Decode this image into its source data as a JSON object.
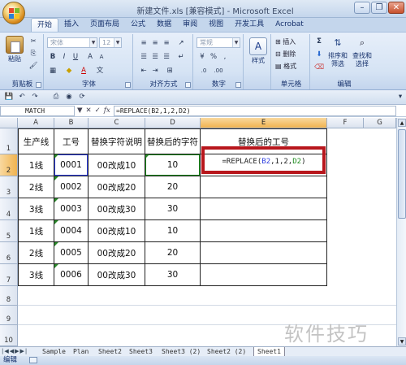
{
  "window": {
    "title": "新建文件.xls [兼容模式] - Microsoft Excel"
  },
  "tabs": [
    "开始",
    "插入",
    "页面布局",
    "公式",
    "数据",
    "审阅",
    "视图",
    "开发工具",
    "Acrobat"
  ],
  "ribbon": {
    "clipboard": {
      "label": "剪贴板",
      "paste": "粘贴"
    },
    "font": {
      "label": "字体",
      "family": "宋体",
      "size": "12"
    },
    "alignment": {
      "label": "对齐方式"
    },
    "number": {
      "label": "数字",
      "format": "常规"
    },
    "styles": {
      "label": "样式"
    },
    "cells": {
      "label": "单元格",
      "insert": "插入",
      "delete": "删除",
      "format": "格式"
    },
    "editing": {
      "label": "编辑",
      "sort": "排序和\n筛选",
      "find": "查找和\n选择"
    }
  },
  "formula_bar": {
    "name_box": "MATCH",
    "formula": "=REPLACE(B2,1,2,D2)",
    "fx": "fx"
  },
  "columns": [
    "A",
    "B",
    "C",
    "D",
    "E",
    "F",
    "G"
  ],
  "rows": [
    "1",
    "2",
    "3",
    "4",
    "5",
    "6",
    "7",
    "8",
    "9",
    "10"
  ],
  "table": {
    "headers": [
      "生产线",
      "工号",
      "替换字符说明",
      "替换后的字符",
      "替换后的工号"
    ],
    "data": [
      [
        "1线",
        "0001",
        "00改成10",
        "10"
      ],
      [
        "2线",
        "0002",
        "00改成20",
        "20"
      ],
      [
        "3线",
        "0003",
        "00改成30",
        "30"
      ],
      [
        "1线",
        "0004",
        "00改成10",
        "10"
      ],
      [
        "2线",
        "0005",
        "00改成20",
        "20"
      ],
      [
        "3线",
        "0006",
        "00改成30",
        "30"
      ]
    ]
  },
  "edit_cell": {
    "prefix": "=REPLACE(",
    "ref1": "B2",
    "mid": ",1,2,",
    "ref2": "D2",
    "suffix": ")"
  },
  "sheets": [
    "Sample",
    "Plan",
    "Sheet2",
    "Sheet3",
    "Sheet3 (2)",
    "Sheet2 (2)",
    "Sheet1"
  ],
  "status": "编辑",
  "watermark": "软件技巧",
  "colors": {
    "accent_red": "#b8161c",
    "ref_blue": "#2f3fe0",
    "ref_green": "#1c8a1c",
    "header_selected": "#f0b350"
  }
}
